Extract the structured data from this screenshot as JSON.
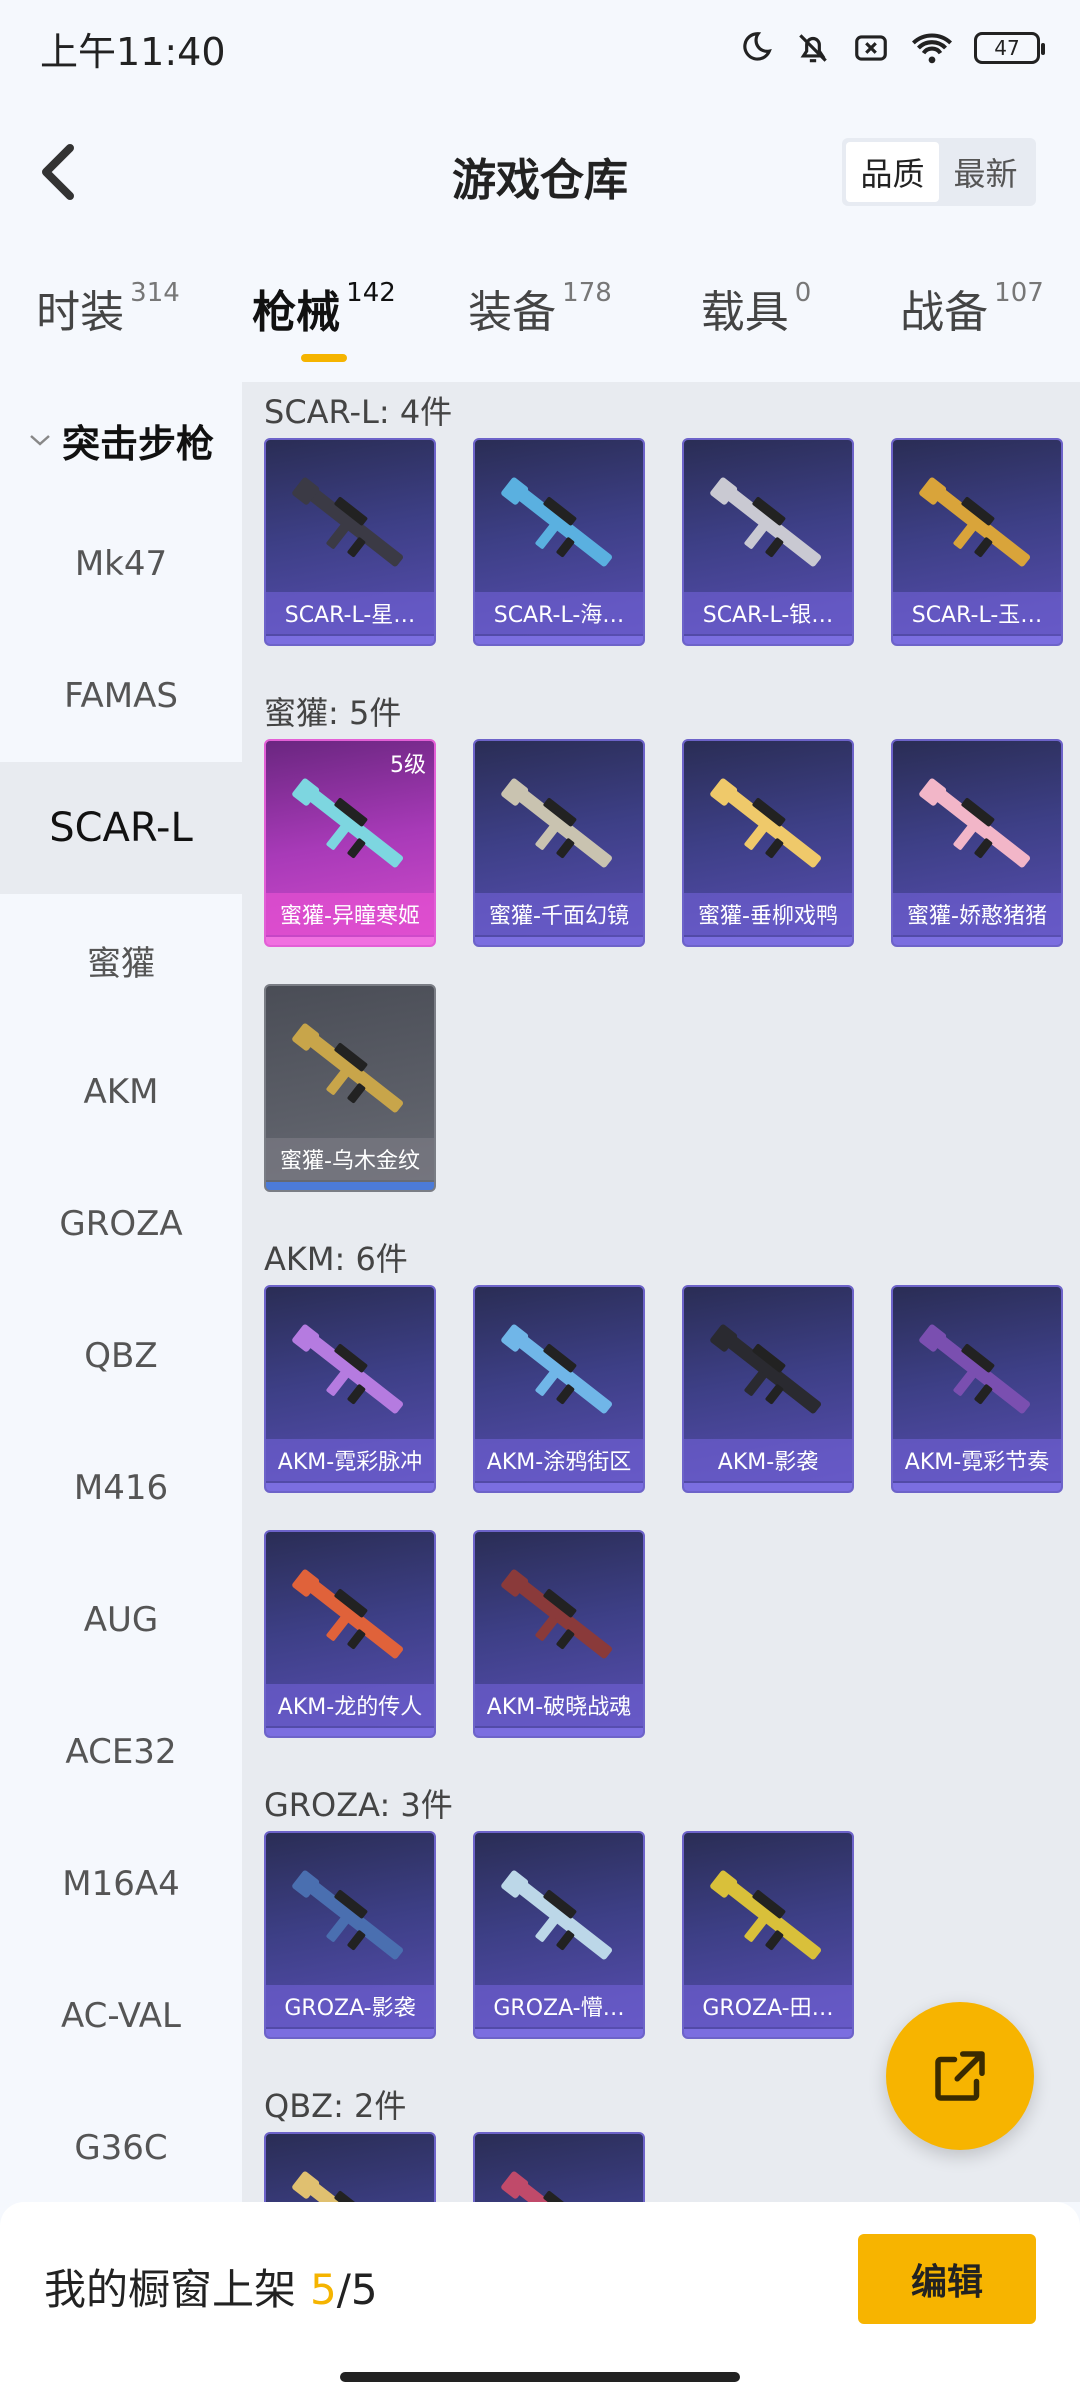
{
  "status_bar": {
    "time": "上午11:40",
    "battery": "47"
  },
  "header": {
    "title": "游戏仓库",
    "sort_options": [
      "品质",
      "最新"
    ],
    "active_sort": "品质"
  },
  "tabs": [
    {
      "label": "时装",
      "count": "314"
    },
    {
      "label": "枪械",
      "count": "142",
      "active": true
    },
    {
      "label": "装备",
      "count": "178"
    },
    {
      "label": "载具",
      "count": "0"
    },
    {
      "label": "战备",
      "count": "107"
    }
  ],
  "sidebar": {
    "group_label": "突击步枪",
    "items": [
      "Mk47",
      "FAMAS",
      "SCAR-L",
      "蜜獾",
      "AKM",
      "GROZA",
      "QBZ",
      "M416",
      "AUG",
      "ACE32",
      "M16A4",
      "AC-VAL",
      "G36C"
    ],
    "active_item": "SCAR-L"
  },
  "sections": [
    {
      "title": "SCAR-L: 4件",
      "items": [
        {
          "name": "SCAR-L-星…",
          "color": "#3b3a45"
        },
        {
          "name": "SCAR-L-海…",
          "color": "#5ab0e0"
        },
        {
          "name": "SCAR-L-银…",
          "color": "#c9c9d2"
        },
        {
          "name": "SCAR-L-玉…",
          "color": "#d9a43a"
        }
      ]
    },
    {
      "title": "蜜獾: 5件",
      "items": [
        {
          "name": "蜜獾-异瞳寒姬",
          "color": "#7dd6e0",
          "variant": "pink",
          "level": "5级"
        },
        {
          "name": "蜜獾-千面幻镜",
          "color": "#c9c3b0"
        },
        {
          "name": "蜜獾-垂柳戏鸭",
          "color": "#efc96a"
        },
        {
          "name": "蜜獾-娇憨猪猪",
          "color": "#f2b6c8"
        },
        {
          "name": "蜜獾-乌木金纹",
          "color": "#c8a54a",
          "variant": "gray"
        }
      ]
    },
    {
      "title": "AKM: 6件",
      "items": [
        {
          "name": "AKM-霓彩脉冲",
          "color": "#b57be0"
        },
        {
          "name": "AKM-涂鸦街区",
          "color": "#70b6e8"
        },
        {
          "name": "AKM-影袭",
          "color": "#2a2a30"
        },
        {
          "name": "AKM-霓彩节奏",
          "color": "#7a4fb0"
        },
        {
          "name": "AKM-龙的传人",
          "color": "#e0623a"
        },
        {
          "name": "AKM-破晓战魂",
          "color": "#8a3a3a"
        }
      ]
    },
    {
      "title": "GROZA: 3件",
      "items": [
        {
          "name": "GROZA-影袭",
          "color": "#4a6fb0"
        },
        {
          "name": "GROZA-懵…",
          "color": "#bcd7e8"
        },
        {
          "name": "GROZA-田…",
          "color": "#d9c03a"
        }
      ]
    },
    {
      "title": "QBZ: 2件",
      "items": [
        {
          "name": "",
          "color": "#e0c070"
        },
        {
          "name": "",
          "color": "#c04a6a"
        }
      ]
    }
  ],
  "bottom_bar": {
    "showcase_label": "我的橱窗上架",
    "current": "5",
    "total": "/5",
    "edit_label": "编辑"
  }
}
